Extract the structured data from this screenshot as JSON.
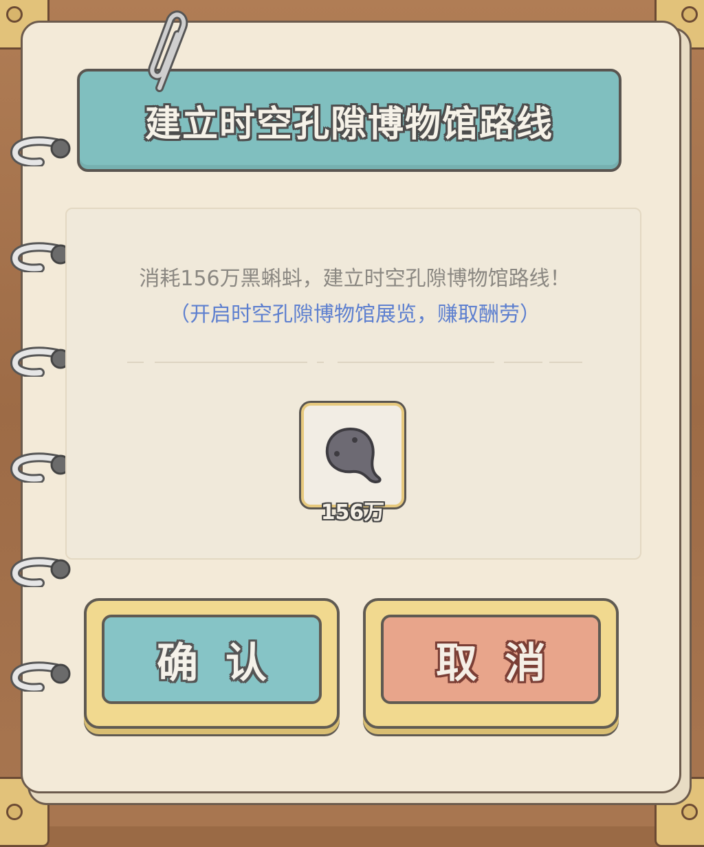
{
  "dialog": {
    "title": "建立时空孔隙博物馆路线",
    "description": "消耗156万黑蝌蚪，建立时空孔隙博物馆路线！",
    "sub_description": "（开启时空孔隙博物馆展览，赚取酬劳）"
  },
  "cost_item": {
    "icon": "black-tadpole-icon",
    "amount": "156万"
  },
  "buttons": {
    "confirm_label": "确认",
    "cancel_label": "取消"
  },
  "colors": {
    "banner": "#80bfbf",
    "confirm": "#86c4c6",
    "cancel": "#e8a58b",
    "subtext": "#5d7fcf"
  }
}
